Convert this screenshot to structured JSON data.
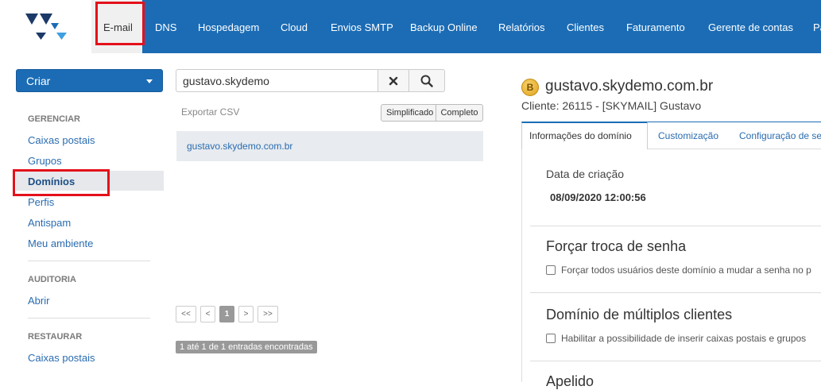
{
  "topnav": {
    "items": [
      "E-mail",
      "DNS",
      "Hospedagem",
      "Cloud",
      "Envios SMTP",
      "Backup Online",
      "Relatórios",
      "Clientes",
      "Faturamento",
      "Gerente de contas",
      "Pa"
    ],
    "active": "E-mail"
  },
  "colors": {
    "brand": "#1b6cb5",
    "highlight": "#e4101b",
    "link": "#2a6cb0"
  },
  "criar_label": "Criar",
  "sidebar": {
    "gerenciar": {
      "heading": "GERENCIAR",
      "items": [
        "Caixas postais",
        "Grupos",
        "Domínios",
        "Perfis",
        "Antispam",
        "Meu ambiente"
      ],
      "active": "Domínios"
    },
    "auditoria": {
      "heading": "AUDITORIA",
      "items": [
        "Abrir"
      ]
    },
    "restaurar": {
      "heading": "RESTAURAR",
      "items": [
        "Caixas postais"
      ]
    }
  },
  "search": {
    "value": "gustavo.skydemo",
    "clear_icon": "close-icon",
    "search_icon": "search-icon"
  },
  "export_label": "Exportar CSV",
  "view_toggle": {
    "simplificado": "Simplificado",
    "completo": "Completo"
  },
  "results": [
    "gustavo.skydemo.com.br"
  ],
  "pagination": {
    "first": "<<",
    "prev": "<",
    "current": "1",
    "next": ">",
    "last": ">>"
  },
  "entries_info": "1 até 1 de 1 entradas encontradas",
  "detail": {
    "badge_letter": "B",
    "title": "gustavo.skydemo.com.br",
    "client": "Cliente: 26115 - [SKYMAIL] Gustavo",
    "tabs": [
      "Informações do domínio",
      "Customização",
      "Configuração de se"
    ],
    "created_label": "Data de criação",
    "created_value": "08/09/2020 12:00:56",
    "force_password": {
      "title": "Forçar troca de senha",
      "checkbox": "Forçar todos usuários deste domínio a mudar a senha no p"
    },
    "multi_client": {
      "title": "Domínio de múltiplos clientes",
      "checkbox": "Habilitar a possibilidade de inserir caixas postais e grupos"
    },
    "next_section": "Apelido"
  }
}
